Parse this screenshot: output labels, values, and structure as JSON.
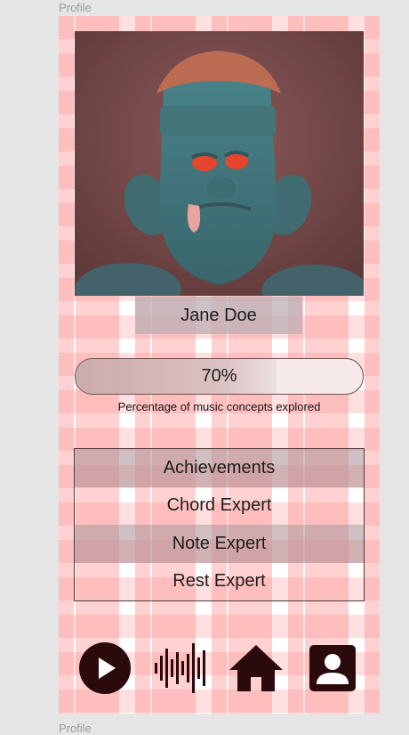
{
  "frame": {
    "label": "Profile",
    "next_label": "Profile"
  },
  "profile": {
    "name": "Jane Doe",
    "progress": {
      "value": 0.7,
      "display": "70%",
      "caption": "Percentage of music concepts explored"
    }
  },
  "achievements": {
    "title": "Achievements",
    "items": [
      "Chord Expert",
      "Note Expert",
      "Rest Expert"
    ]
  },
  "nav": {
    "items": [
      {
        "icon": "play-icon"
      },
      {
        "icon": "waveform-icon"
      },
      {
        "icon": "home-icon"
      },
      {
        "icon": "profile-icon"
      }
    ]
  },
  "colors": {
    "icon": "#2a0a0a",
    "grid": "#ff8c8c"
  }
}
